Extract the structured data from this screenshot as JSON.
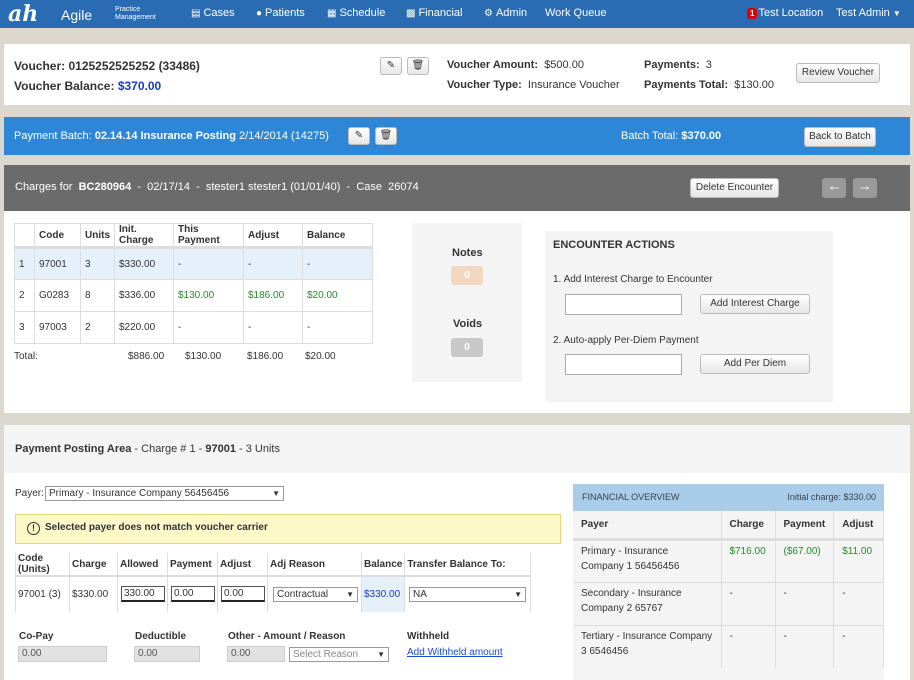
{
  "nav": {
    "logo": "ah",
    "brand": "Agile",
    "brand_sub1": "Practice",
    "brand_sub2": "Management",
    "items": [
      "Cases",
      "Patients",
      "Schedule",
      "Financial",
      "Admin",
      "Work Queue"
    ],
    "badge": "1",
    "location": "Test Location",
    "user": "Test Admin"
  },
  "voucher": {
    "label": "Voucher:",
    "id": "0125252525252 (33486)",
    "balance_label": "Voucher Balance:",
    "balance": "$370.00",
    "amount_label": "Voucher Amount:",
    "amount": "$500.00",
    "type_label": "Voucher Type:",
    "type": "Insurance Voucher",
    "payments_label": "Payments:",
    "payments": "3",
    "payments_total_label": "Payments Total:",
    "payments_total": "$130.00",
    "review_button": "Review Voucher"
  },
  "batch": {
    "label": "Payment Batch:",
    "name": "02.14.14 Insurance Posting",
    "date": "2/14/2014 (14275)",
    "total_label": "Batch Total:",
    "total": "$370.00",
    "back_button": "Back to Batch"
  },
  "encounter": {
    "prefix": "Charges for",
    "id": "BC280964",
    "sep1": "-",
    "date": "02/17/14",
    "sep2": "-",
    "patient": "stester1 stester1 (01/01/40)",
    "sep3": "-",
    "case_label": "Case",
    "case": "26074",
    "delete_button": "Delete Encounter"
  },
  "charges": {
    "headers": [
      "Code",
      "Units",
      "Init. Charge",
      "This Payment",
      "Adjust",
      "Balance"
    ],
    "rows": [
      {
        "n": "1",
        "code": "97001",
        "units": "3",
        "init": "$330.00",
        "pay": "-",
        "adj": "-",
        "bal": "-"
      },
      {
        "n": "2",
        "code": "G0283",
        "units": "8",
        "init": "$336.00",
        "pay": "$130.00",
        "adj": "$186.00",
        "bal": "$20.00"
      },
      {
        "n": "3",
        "code": "97003",
        "units": "2",
        "init": "$220.00",
        "pay": "-",
        "adj": "-",
        "bal": "-"
      }
    ],
    "total_label": "Total:",
    "totals": {
      "init": "$886.00",
      "pay": "$130.00",
      "adj": "$186.00",
      "bal": "$20.00"
    }
  },
  "notes": {
    "label": "Notes",
    "count": "0",
    "voids_label": "Voids",
    "voids_count": "0"
  },
  "actions": {
    "title": "ENCOUNTER ACTIONS",
    "interest_label": "1. Add Interest Charge to Encounter",
    "interest_button": "Add Interest Charge",
    "perdiem_label": "2. Auto-apply Per-Diem Payment",
    "perdiem_button": "Add Per Diem"
  },
  "posting": {
    "title": "Payment Posting Area",
    "sub1": "- Charge # 1 -",
    "code": "97001",
    "sub2": "- 3 Units",
    "payer_label": "Payer:",
    "payer": "Primary - Insurance Company 56456456",
    "warning": "Selected payer does not match voucher carrier",
    "headers": [
      "Code (Units)",
      "Charge",
      "Allowed",
      "Payment",
      "Adjust",
      "Adj Reason",
      "Balance",
      "Transfer Balance To:"
    ],
    "row": {
      "code": "97001 (3)",
      "charge": "$330.00",
      "allowed": "330.00",
      "payment": "0.00",
      "adjust": "0.00",
      "reason": "Contractual",
      "balance": "$330.00",
      "transfer": "NA"
    },
    "copay_label": "Co-Pay",
    "copay": "0.00",
    "deductible_label": "Deductible",
    "deductible": "0.00",
    "other_label": "Other - Amount / Reason",
    "other": "0.00",
    "reason_placeholder": "Select Reason",
    "withheld_label": "Withheld",
    "withheld_link": "Add Withheld amount"
  },
  "overview": {
    "title": "FINANCIAL OVERVIEW",
    "initial": "Initial charge: $330.00",
    "headers": [
      "Payer",
      "Charge",
      "Payment",
      "Adjust"
    ],
    "rows": [
      {
        "payer": "Primary - Insurance Company 1 56456456",
        "charge": "$716.00",
        "payment": "($67.00)",
        "adjust": "$11.00"
      },
      {
        "payer": "Secondary - Insurance Company 2 65767",
        "charge": "-",
        "payment": "-",
        "adjust": "-"
      },
      {
        "payer": "Tertiary - Insurance Company 3 6546456",
        "charge": "-",
        "payment": "-",
        "adjust": "-"
      }
    ]
  }
}
